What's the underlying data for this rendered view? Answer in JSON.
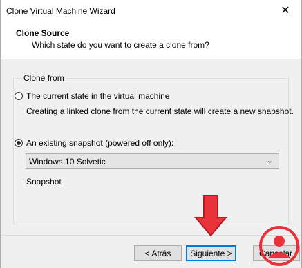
{
  "window": {
    "title": "Clone Virtual Machine Wizard",
    "close_glyph": "✕"
  },
  "header": {
    "title": "Clone Source",
    "subtitle": "Which state do you want to create a clone from?"
  },
  "clone_from": {
    "label": "Clone from",
    "options": [
      {
        "label": "The current state in the virtual machine",
        "checked": false
      },
      {
        "label": "An existing snapshot (powered off only):",
        "checked": true
      }
    ],
    "description": "Creating a linked clone from the current state will create a new snapshot.",
    "snapshot_select": {
      "value": "Windows 10 Solvetic"
    },
    "snapshot_label": "Snapshot"
  },
  "buttons": {
    "back": "< Atrás",
    "next": "Siguiente >",
    "cancel": "Cancelar"
  },
  "overlay": {
    "arrow_color": "#e8333a",
    "watermark_color": "#e8333a"
  }
}
